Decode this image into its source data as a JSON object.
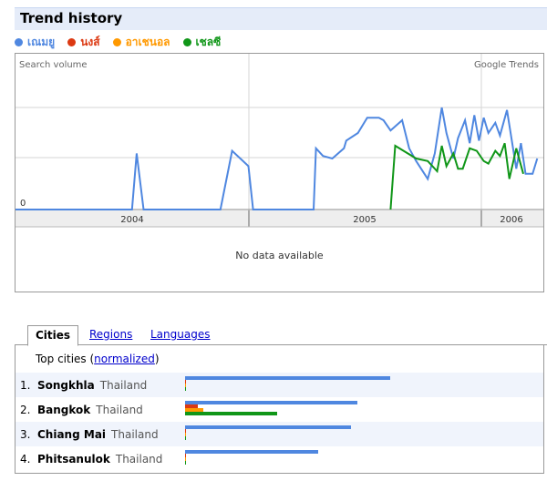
{
  "title": "Trend history",
  "legend": [
    {
      "label": "เณมยู",
      "color": "#4f87e0"
    },
    {
      "label": "นงส์",
      "color": "#dc3912"
    },
    {
      "label": "อาเชนอล",
      "color": "#ff9900"
    },
    {
      "label": "เชลซี",
      "color": "#109618"
    }
  ],
  "chart": {
    "search_volume_label": "Search volume",
    "brand_label": "Google Trends",
    "zero_label": "0",
    "years": [
      "2004",
      "2005",
      "2006"
    ],
    "no_data_text": "No data available"
  },
  "chart_data": {
    "type": "line",
    "ylabel": "Search volume",
    "x_ticks": [
      "2004",
      "2005",
      "2006"
    ],
    "series": [
      {
        "name": "เณมยู",
        "color": "#4f87e0",
        "points": [
          [
            0,
            0
          ],
          [
            0.05,
            0
          ],
          [
            0.12,
            0
          ],
          [
            0.25,
            0
          ],
          [
            0.26,
            1.1
          ],
          [
            0.275,
            0
          ],
          [
            0.36,
            0
          ],
          [
            0.44,
            0
          ],
          [
            0.465,
            1.15
          ],
          [
            0.5,
            0.85
          ],
          [
            0.51,
            0
          ],
          [
            0.6,
            0
          ],
          [
            0.64,
            0
          ],
          [
            0.645,
            1.2
          ],
          [
            0.66,
            1.05
          ],
          [
            0.68,
            1.0
          ],
          [
            0.705,
            1.2
          ],
          [
            0.71,
            1.35
          ],
          [
            0.735,
            1.5
          ],
          [
            0.755,
            1.8
          ],
          [
            0.78,
            1.8
          ],
          [
            0.79,
            1.75
          ],
          [
            0.805,
            1.55
          ],
          [
            0.83,
            1.75
          ],
          [
            0.845,
            1.2
          ],
          [
            0.86,
            0.95
          ],
          [
            0.885,
            0.6
          ],
          [
            0.9,
            1.1
          ],
          [
            0.915,
            2.0
          ],
          [
            0.925,
            1.5
          ],
          [
            0.94,
            1.0
          ],
          [
            0.95,
            1.4
          ],
          [
            0.965,
            1.75
          ],
          [
            0.975,
            1.3
          ],
          [
            0.985,
            1.85
          ],
          [
            0.995,
            1.35
          ],
          [
            1.005,
            1.8
          ],
          [
            1.015,
            1.5
          ],
          [
            1.03,
            1.7
          ],
          [
            1.04,
            1.45
          ],
          [
            1.055,
            1.95
          ],
          [
            1.075,
            0.8
          ],
          [
            1.085,
            1.3
          ],
          [
            1.095,
            0.7
          ],
          [
            1.11,
            0.7
          ],
          [
            1.12,
            1.0
          ]
        ]
      },
      {
        "name": "นงส์",
        "color": "#dc3912",
        "points": []
      },
      {
        "name": "อาเชนอล",
        "color": "#ff9900",
        "points": []
      },
      {
        "name": "เชลซี",
        "color": "#109618",
        "points": [
          [
            0.805,
            0
          ],
          [
            0.815,
            1.25
          ],
          [
            0.86,
            1.0
          ],
          [
            0.885,
            0.95
          ],
          [
            0.905,
            0.75
          ],
          [
            0.915,
            1.25
          ],
          [
            0.925,
            0.85
          ],
          [
            0.94,
            1.1
          ],
          [
            0.95,
            0.8
          ],
          [
            0.96,
            0.8
          ],
          [
            0.975,
            1.2
          ],
          [
            0.99,
            1.15
          ],
          [
            1.005,
            0.95
          ],
          [
            1.015,
            0.9
          ],
          [
            1.03,
            1.15
          ],
          [
            1.04,
            1.05
          ],
          [
            1.05,
            1.3
          ],
          [
            1.06,
            0.6
          ],
          [
            1.075,
            1.2
          ],
          [
            1.09,
            0.7
          ]
        ]
      }
    ],
    "ylim": [
      0,
      2.1
    ]
  },
  "tabs": [
    {
      "label": "Cities"
    },
    {
      "label": "Regions"
    },
    {
      "label": "Languages"
    }
  ],
  "top_cities_label": "Top cities (",
  "normalized_label": "normalized",
  "top_cities_close": ")",
  "cities": [
    {
      "rank": "1.",
      "city": "Songkhla",
      "country": "Thailand",
      "values": [
        1.0,
        0.005,
        0.005,
        0.005
      ]
    },
    {
      "rank": "2.",
      "city": "Bangkok",
      "country": "Thailand",
      "values": [
        0.84,
        0.06,
        0.09,
        0.45
      ]
    },
    {
      "rank": "3.",
      "city": "Chiang Mai",
      "country": "Thailand",
      "values": [
        0.81,
        0.005,
        0.005,
        0.005
      ]
    },
    {
      "rank": "4.",
      "city": "Phitsanulok",
      "country": "Thailand",
      "values": [
        0.65,
        0.005,
        0.005,
        0.005
      ]
    }
  ]
}
